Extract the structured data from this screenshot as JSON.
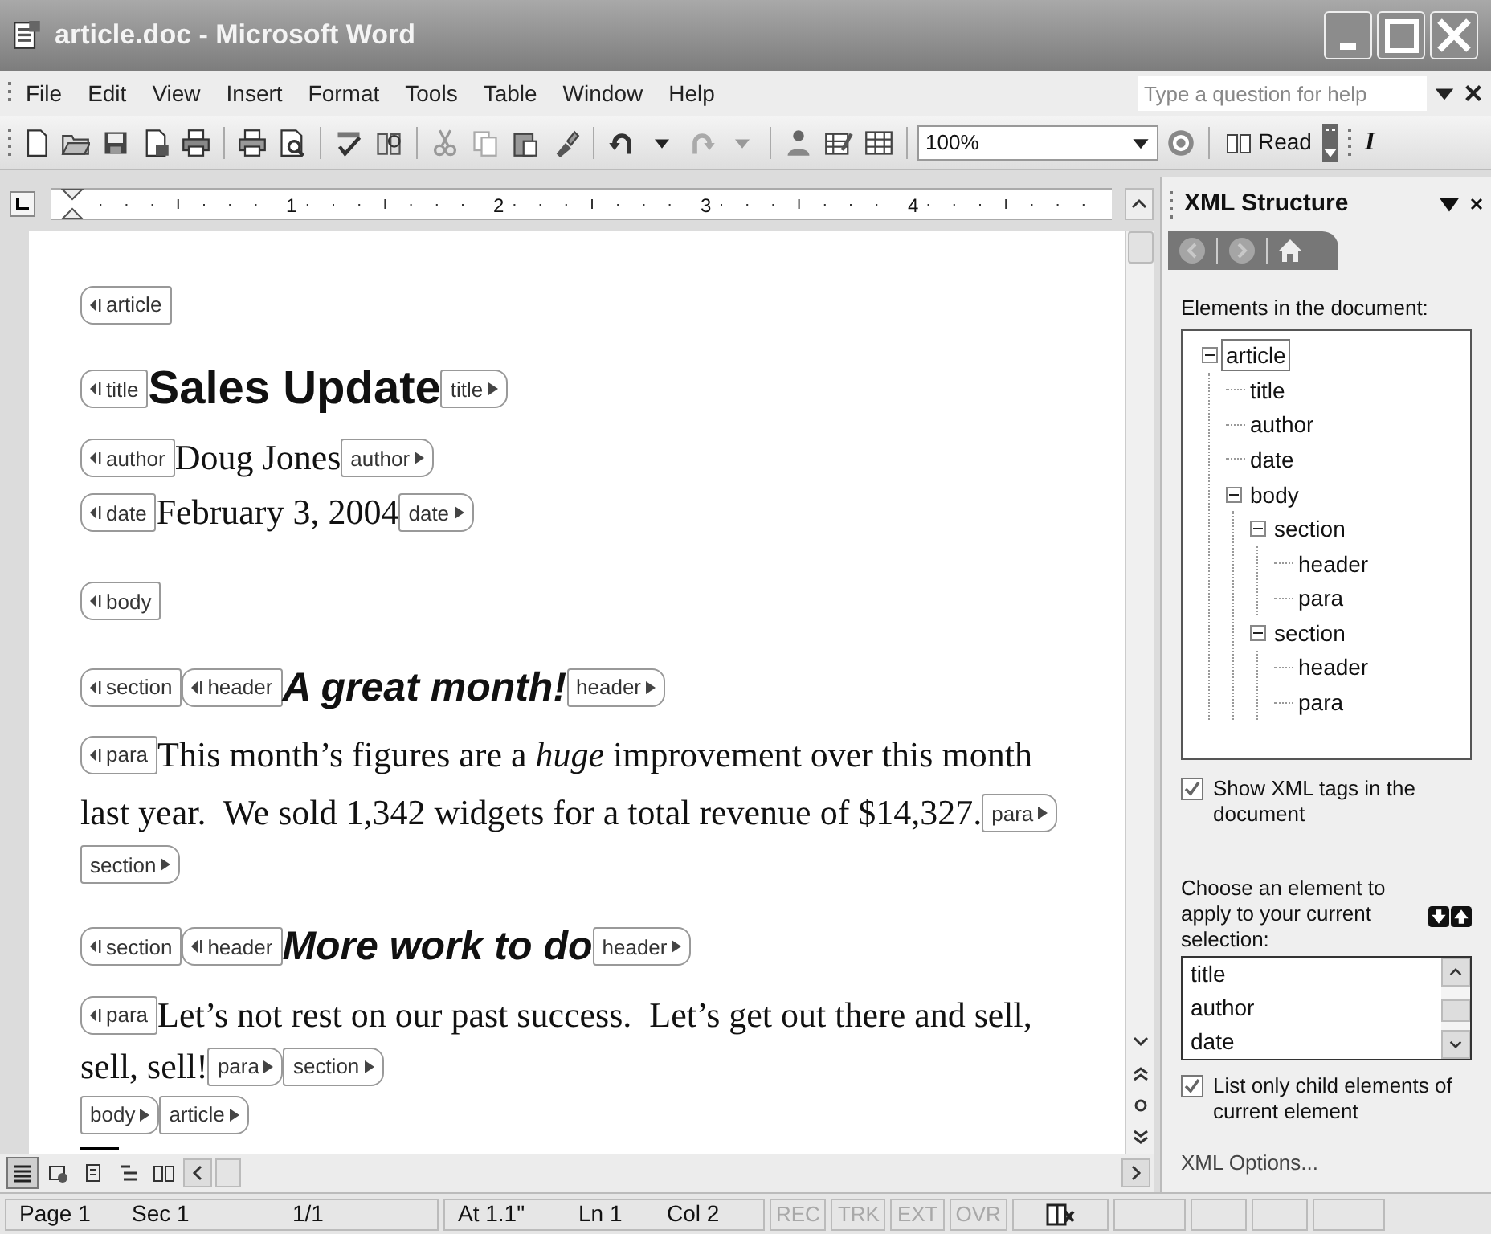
{
  "window": {
    "title": "article.doc - Microsoft Word"
  },
  "menu": [
    "File",
    "Edit",
    "View",
    "Insert",
    "Format",
    "Tools",
    "Table",
    "Window",
    "Help"
  ],
  "help_box": {
    "placeholder": "Type a question for help"
  },
  "toolbar": {
    "zoom": "100%",
    "read_button": "Read",
    "italic_button": "I"
  },
  "ruler": {
    "labels": [
      "1",
      "2",
      "3",
      "4"
    ]
  },
  "document": {
    "blocks": [
      [
        {
          "kind": "open",
          "tag": "article"
        }
      ],
      [
        {
          "kind": "open",
          "tag": "title"
        },
        {
          "kind": "title",
          "text": "Sales Update"
        },
        {
          "kind": "close",
          "tag": "title"
        }
      ],
      [
        {
          "kind": "open",
          "tag": "author"
        },
        {
          "kind": "body",
          "text": "Doug Jones"
        },
        {
          "kind": "close",
          "tag": "author"
        }
      ],
      [
        {
          "kind": "open",
          "tag": "date"
        },
        {
          "kind": "body",
          "text": "February 3, 2004"
        },
        {
          "kind": "close",
          "tag": "date"
        }
      ],
      [
        {
          "kind": "open",
          "tag": "body"
        }
      ],
      [
        {
          "kind": "open",
          "tag": "section"
        },
        {
          "kind": "open",
          "tag": "header"
        },
        {
          "kind": "heading",
          "text": "A great month!"
        },
        {
          "kind": "close",
          "tag": "header"
        }
      ],
      [
        {
          "kind": "open",
          "tag": "para"
        },
        {
          "kind": "body",
          "lines": [
            "This month’s figures are a *huge* improvement over this month",
            "last year.  We sold 1,342 widgets for a total revenue of $14,327."
          ]
        },
        {
          "kind": "close",
          "tag": "para"
        }
      ],
      [
        {
          "kind": "close",
          "tag": "section"
        }
      ],
      [
        {
          "kind": "open",
          "tag": "section"
        },
        {
          "kind": "open",
          "tag": "header"
        },
        {
          "kind": "heading",
          "text": "More work to do"
        },
        {
          "kind": "close",
          "tag": "header"
        }
      ],
      [
        {
          "kind": "open",
          "tag": "para"
        },
        {
          "kind": "body",
          "lines": [
            "Let’s not rest on our past success.  Let’s get out there and sell,",
            "sell, sell!"
          ]
        },
        {
          "kind": "close",
          "tag": "para"
        },
        {
          "kind": "close",
          "tag": "section"
        }
      ],
      [
        {
          "kind": "close",
          "tag": "body"
        },
        {
          "kind": "close",
          "tag": "article"
        }
      ]
    ]
  },
  "xml_panel": {
    "title": "XML Structure",
    "elements_label": "Elements in the document:",
    "tree": [
      {
        "label": "article",
        "selected": true,
        "expanded": true,
        "children": [
          {
            "label": "title",
            "selected": false
          },
          {
            "label": "author",
            "selected": false
          },
          {
            "label": "date",
            "selected": false
          },
          {
            "label": "body",
            "selected": false,
            "expanded": true,
            "children": [
              {
                "label": "section",
                "selected": false,
                "expanded": true,
                "children": [
                  {
                    "label": "header",
                    "selected": false
                  },
                  {
                    "label": "para",
                    "selected": false
                  }
                ]
              },
              {
                "label": "section",
                "selected": false,
                "expanded": true,
                "children": [
                  {
                    "label": "header",
                    "selected": false
                  },
                  {
                    "label": "para",
                    "selected": false
                  }
                ]
              }
            ]
          }
        ]
      }
    ],
    "show_tags": {
      "label": "Show XML tags in the document",
      "checked": true
    },
    "choose_label": "Choose an element to apply to your current selection:",
    "element_list": [
      "title",
      "author",
      "date"
    ],
    "child_only": {
      "label": "List only child elements of current element",
      "checked": true
    },
    "options_link": "XML Options..."
  },
  "status_bar": {
    "sections": [
      {
        "items": [
          "Page 1",
          "Sec 1",
          "1/1"
        ]
      },
      {
        "items": [
          "At 1.1\"",
          "Ln 1",
          "Col 2"
        ]
      }
    ],
    "modes": [
      {
        "text": "REC",
        "disabled": true
      },
      {
        "text": "TRK",
        "disabled": true
      },
      {
        "text": "EXT",
        "disabled": true
      },
      {
        "text": "OVR",
        "disabled": true
      }
    ]
  }
}
